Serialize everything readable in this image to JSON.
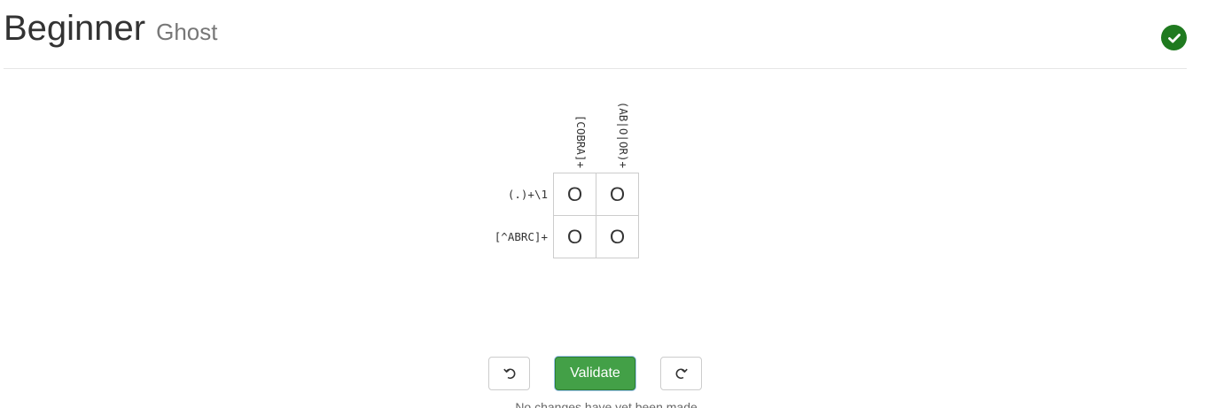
{
  "header": {
    "title": "Beginner",
    "subtitle": "Ghost",
    "status_icon": "check-circle-icon",
    "status_color": "#1f7a1f"
  },
  "puzzle": {
    "column_clues": [
      "[COBRA]+",
      "(AB|O|OR)+"
    ],
    "row_clues": [
      "(.)+\\1",
      "[^ABRC]+"
    ],
    "cells": [
      [
        "O",
        "O"
      ],
      [
        "O",
        "O"
      ]
    ]
  },
  "controls": {
    "undo_icon": "undo-icon",
    "validate_label": "Validate",
    "redo_icon": "redo-icon",
    "validate_color": "#43a047"
  },
  "footnote": "No changes have yet been made."
}
